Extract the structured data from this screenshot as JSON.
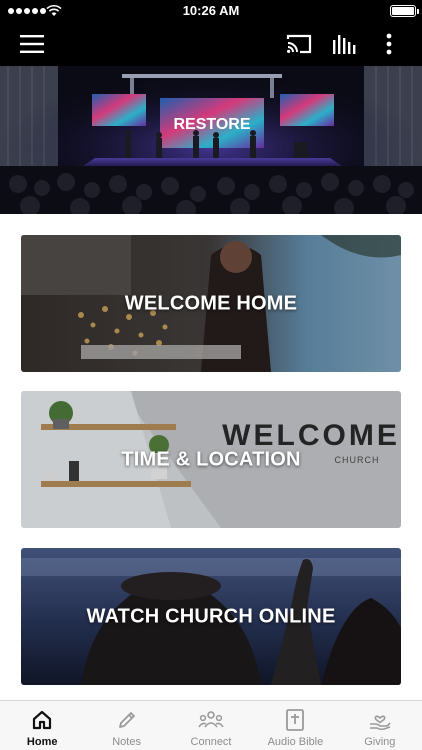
{
  "status_bar": {
    "time": "10:26 AM",
    "battery_level": 1.0,
    "signal_bars": 5
  },
  "nav": {
    "menu_icon": "hamburger-menu-icon",
    "cast_icon": "cast-icon",
    "audio_icon": "audio-bars-icon",
    "more_icon": "more-vertical-icon"
  },
  "hero": {
    "screen_text": "RESTORE"
  },
  "cards": [
    {
      "label": "WELCOME HOME"
    },
    {
      "label": "TIME & LOCATION",
      "wall_sign": "WELCOME",
      "wall_sign_sub": "CHURCH"
    },
    {
      "label": "WATCH CHURCH ONLINE"
    }
  ],
  "tabs": [
    {
      "label": "Home",
      "icon": "home-icon",
      "active": true
    },
    {
      "label": "Notes",
      "icon": "pencil-icon",
      "active": false
    },
    {
      "label": "Connect",
      "icon": "people-icon",
      "active": false
    },
    {
      "label": "Audio Bible",
      "icon": "bible-icon",
      "active": false
    },
    {
      "label": "Giving",
      "icon": "giving-hand-icon",
      "active": false
    }
  ],
  "colors": {
    "bar_background": "#000000",
    "tab_active": "#111111",
    "tab_inactive": "#8e8e8e"
  }
}
